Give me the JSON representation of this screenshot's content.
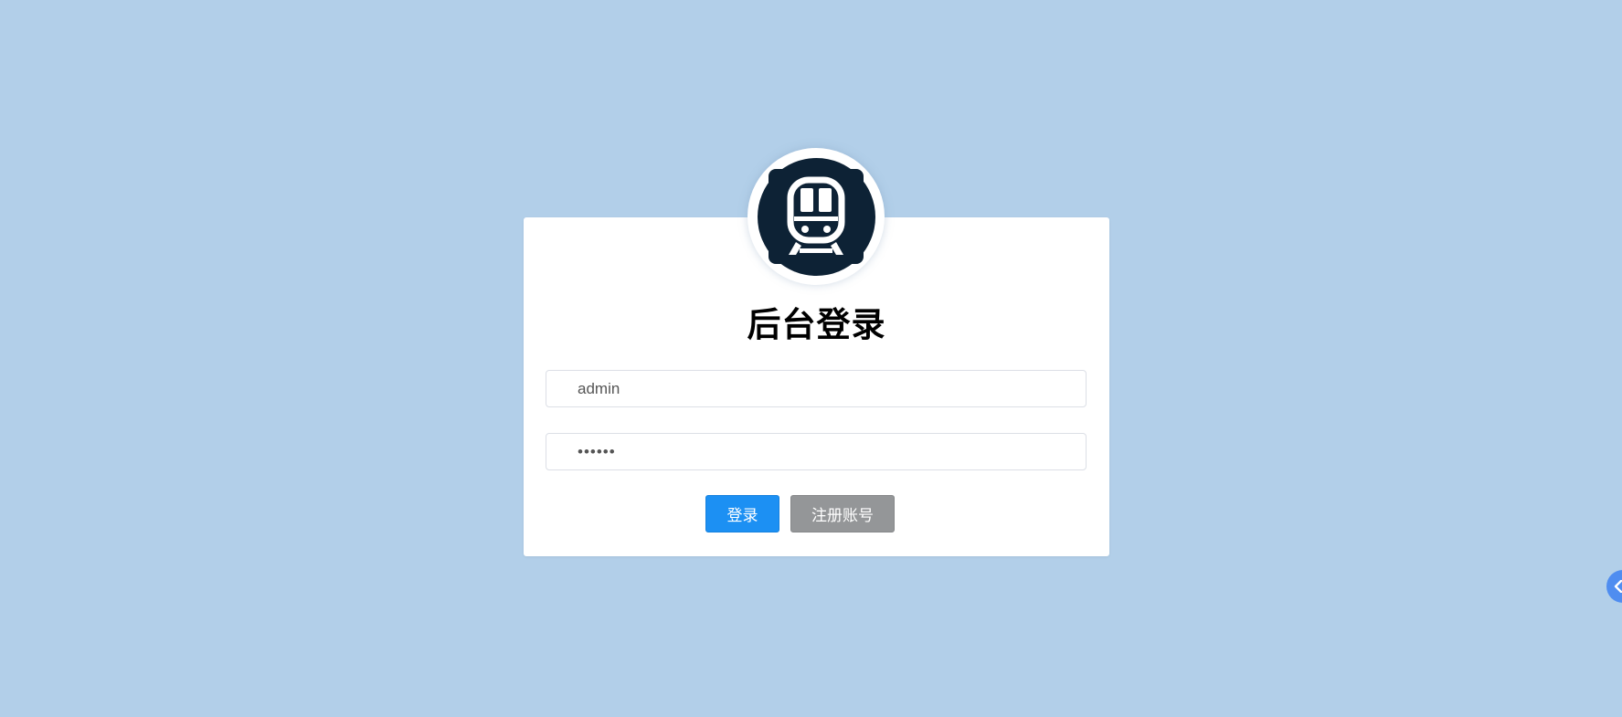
{
  "login": {
    "title": "后台登录",
    "username": {
      "value": "admin",
      "placeholder": ""
    },
    "password": {
      "value": "••••••",
      "placeholder": ""
    },
    "login_button": "登录",
    "register_button": "注册账号"
  },
  "logo": {
    "icon": "train-icon"
  },
  "side_handle": {
    "icon": "chevron-left-icon"
  },
  "colors": {
    "background": "#b2cfe9",
    "card": "#ffffff",
    "primary_button": "#1c90f3",
    "secondary_button": "#949698",
    "logo_dark": "#0d2235",
    "side_handle": "#4f8df0"
  }
}
